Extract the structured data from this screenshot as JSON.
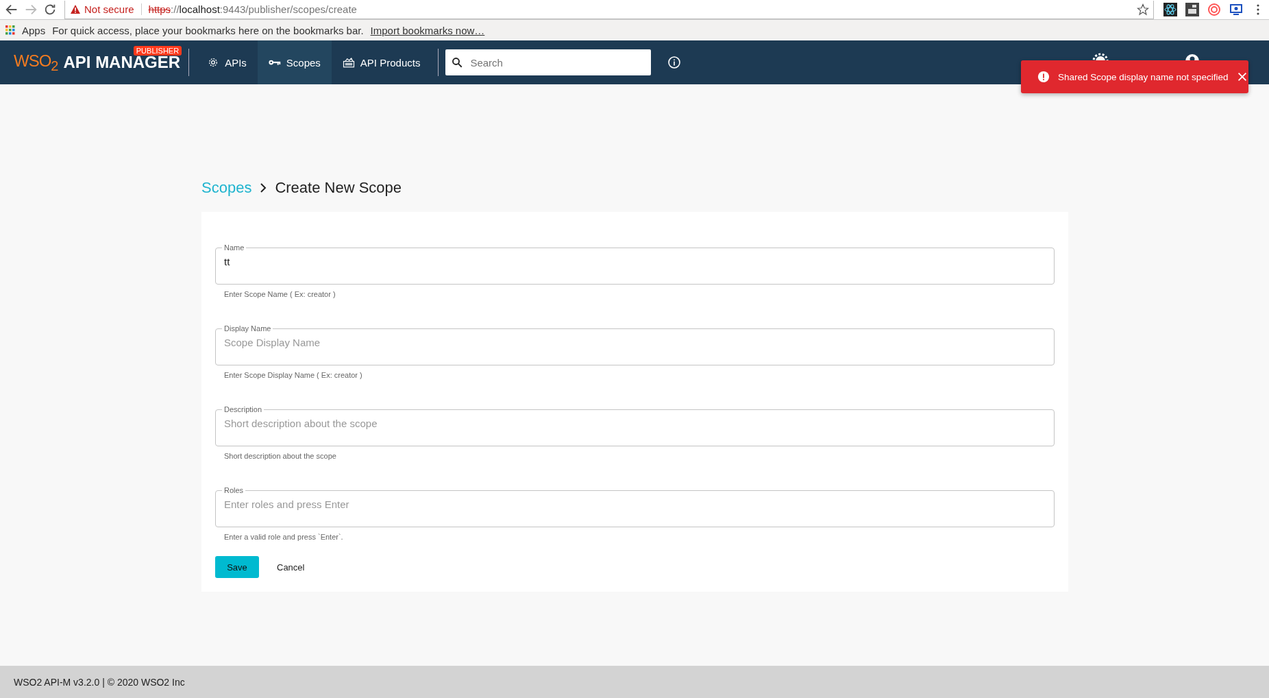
{
  "browser": {
    "not_secure_label": "Not secure",
    "url": {
      "scheme": "https",
      "separator": "://",
      "host": "localhost",
      "path": ":9443/publisher/scopes/create"
    },
    "bookmarks": {
      "apps_label": "Apps",
      "hint": "For quick access, place your bookmarks here on the bookmarks bar.",
      "import_link": "Import bookmarks now…"
    }
  },
  "header": {
    "logo": "WSO$_{2}$",
    "product": "API MANAGER",
    "badge": "PUBLISHER",
    "nav": [
      {
        "label": "APIs",
        "kind": "gear",
        "selected": false
      },
      {
        "label": "Scopes",
        "kind": "key",
        "selected": true
      },
      {
        "label": "API Products",
        "kind": "products",
        "selected": false
      }
    ],
    "search": {
      "placeholder": "Search"
    }
  },
  "toast": {
    "message": "Shared Scope display name not specified"
  },
  "breadcrumb": {
    "parent": "Scopes",
    "current": "Create New Scope"
  },
  "fields": [
    {
      "label": "Name",
      "value": "tt",
      "helper": "Enter Scope Name ( Ex: creator )"
    },
    {
      "label": "Display Name",
      "placeholder": "Scope Display Name",
      "helper": "Enter Scope Display Name ( Ex: creator )"
    },
    {
      "label": "Description",
      "placeholder": "Short description about the scope",
      "helper": "Short description about the scope"
    },
    {
      "label": "Roles",
      "placeholder": "Enter roles and press Enter",
      "helper": "Enter a valid role and press `Enter`."
    }
  ],
  "buttons": {
    "save": "Save",
    "cancel": "Cancel"
  },
  "footer": "WSO2 API-M v3.2.0 | © 2020 WSO2 Inc"
}
